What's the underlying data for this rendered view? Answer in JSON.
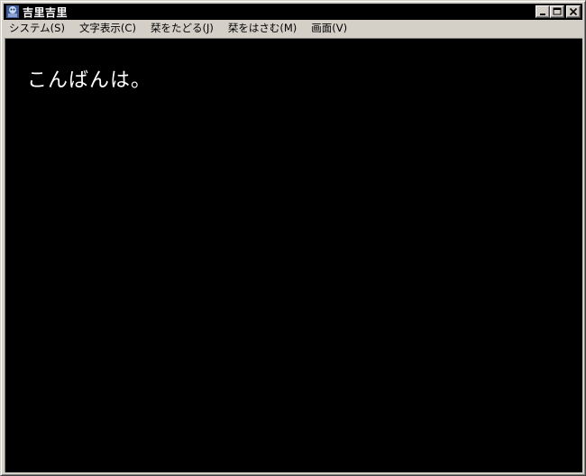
{
  "window": {
    "title": "吉里吉里",
    "icon": "kirikiri-app-icon"
  },
  "caption_buttons": {
    "minimize_icon": "minimize-icon",
    "maximize_icon": "maximize-icon",
    "close_icon": "close-icon"
  },
  "menu": {
    "items": [
      {
        "label": "システム(S)"
      },
      {
        "label": "文字表示(C)"
      },
      {
        "label": "栞をたどる(J)"
      },
      {
        "label": "栞をはさむ(M)"
      },
      {
        "label": "画面(V)"
      }
    ]
  },
  "content": {
    "message": "こんばんは。",
    "background_color": "#000000",
    "text_color": "#ffffff"
  }
}
